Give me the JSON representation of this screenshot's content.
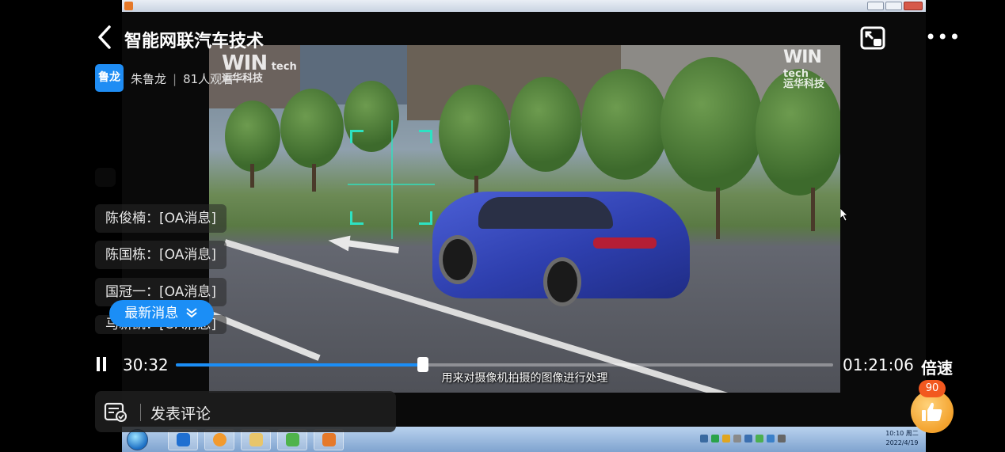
{
  "header": {
    "title": "智能网联汽车技术",
    "back_icon": "chevron-left-icon",
    "pip_icon": "picture-in-picture-icon",
    "more_icon": "more-horizontal-icon"
  },
  "host": {
    "avatar_text": "鲁龙",
    "name": "朱鲁龙",
    "viewers": "81人观看",
    "avatar_color": "#1f8df4"
  },
  "chat": {
    "messages": [
      {
        "text": "陈俊楠：[OA消息]"
      },
      {
        "text": "陈国栋：[OA消息]"
      },
      {
        "text": "国冠一：[OA消息]"
      },
      {
        "text": "马新凯：[OA消息]"
      }
    ],
    "latest_button": "最新消息"
  },
  "player": {
    "current_time": "30:32",
    "total_time": "01:21:06",
    "speed_label": "倍速",
    "progress": 0.3765,
    "accent_color": "#1b8ef6"
  },
  "video": {
    "watermark_left_big": "WIN",
    "watermark_left_small": "tech",
    "watermark_left_cn": "运华科技",
    "watermark_right_big": "WIN",
    "watermark_right_small": "tech",
    "watermark_right_cn": "运华科技",
    "subtitle": "用来对摄像机拍摄的图像进行处理"
  },
  "taskbar": {
    "clock_time": "10:10 周二",
    "clock_date": "2022/4/19"
  },
  "comment": {
    "label": "发表评论",
    "icon": "comment-edit-icon"
  },
  "like": {
    "count": "90",
    "icon": "thumbs-up-icon"
  }
}
